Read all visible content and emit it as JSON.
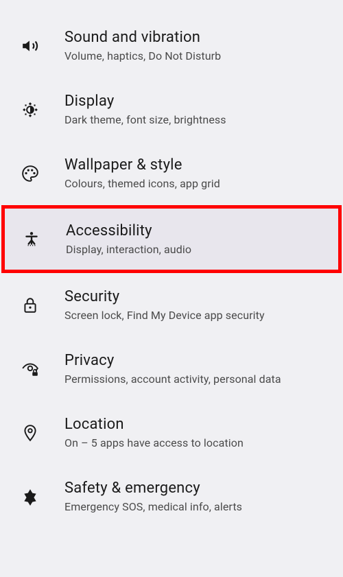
{
  "settings": [
    {
      "id": "sound",
      "title": "Sound and vibration",
      "subtitle": "Volume, haptics, Do Not Disturb",
      "icon": "volume",
      "highlighted": false
    },
    {
      "id": "display",
      "title": "Display",
      "subtitle": "Dark theme, font size, brightness",
      "icon": "brightness",
      "highlighted": false
    },
    {
      "id": "wallpaper",
      "title": "Wallpaper & style",
      "subtitle": "Colours, themed icons, app grid",
      "icon": "palette",
      "highlighted": false
    },
    {
      "id": "accessibility",
      "title": "Accessibility",
      "subtitle": "Display, interaction, audio",
      "icon": "accessibility",
      "highlighted": true
    },
    {
      "id": "security",
      "title": "Security",
      "subtitle": "Screen lock, Find My Device app security",
      "icon": "lock",
      "highlighted": false
    },
    {
      "id": "privacy",
      "title": "Privacy",
      "subtitle": "Permissions, account activity, personal data",
      "icon": "eye-lock",
      "highlighted": false
    },
    {
      "id": "location",
      "title": "Location",
      "subtitle": "On – 5 apps have access to location",
      "icon": "pin",
      "highlighted": false
    },
    {
      "id": "safety",
      "title": "Safety & emergency",
      "subtitle": "Emergency SOS, medical info, alerts",
      "icon": "medical",
      "highlighted": false
    }
  ]
}
